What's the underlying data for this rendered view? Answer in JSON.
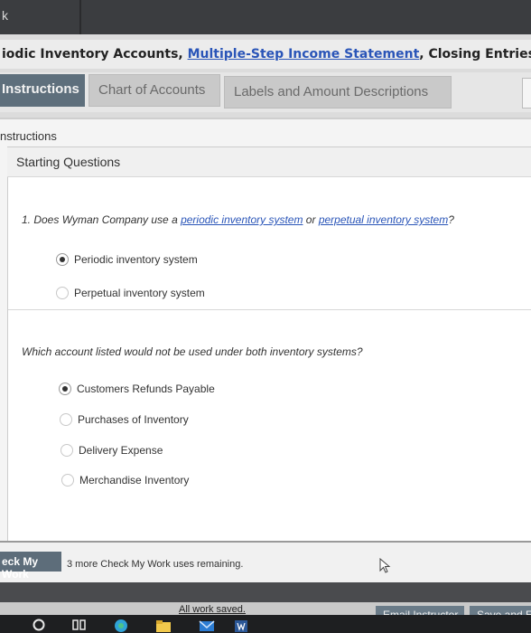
{
  "window": {
    "corner_letter": "k"
  },
  "header": {
    "title_part1": "iodic Inventory Accounts, ",
    "title_link": "Multiple-Step Income Statement",
    "title_part2": ", Closing Entries"
  },
  "tabs": [
    {
      "label": "Instructions",
      "active": true
    },
    {
      "label": "Chart of Accounts",
      "active": false
    },
    {
      "label": "Labels and Amount Descriptions",
      "active": false
    }
  ],
  "panel": {
    "heading": "nstructions",
    "section_title": "Starting Questions"
  },
  "question1": {
    "prefix": "1. Does Wyman Company use a ",
    "link1": "periodic inventory system",
    "middle": " or ",
    "link2": "perpetual inventory system",
    "suffix": "?",
    "options": [
      {
        "label": "Periodic inventory system",
        "selected": true
      },
      {
        "label": "Perpetual inventory system",
        "selected": false
      }
    ]
  },
  "question2": {
    "text": "Which account listed would not be used under both inventory systems?",
    "options": [
      {
        "label": "Customers Refunds Payable",
        "selected": true
      },
      {
        "label": "Purchases of Inventory",
        "selected": false
      },
      {
        "label": "Delivery Expense",
        "selected": false
      },
      {
        "label": "Merchandise Inventory",
        "selected": false
      }
    ]
  },
  "footer": {
    "check_label": "eck My Work",
    "remaining_text": "3 more Check My Work uses remaining."
  },
  "status": {
    "saved_text": "All work saved.",
    "email_label": "Email Instructor",
    "save_label": "Save and Ex"
  },
  "colors": {
    "accent": "#5e6f7c",
    "link": "#2a55b8"
  }
}
